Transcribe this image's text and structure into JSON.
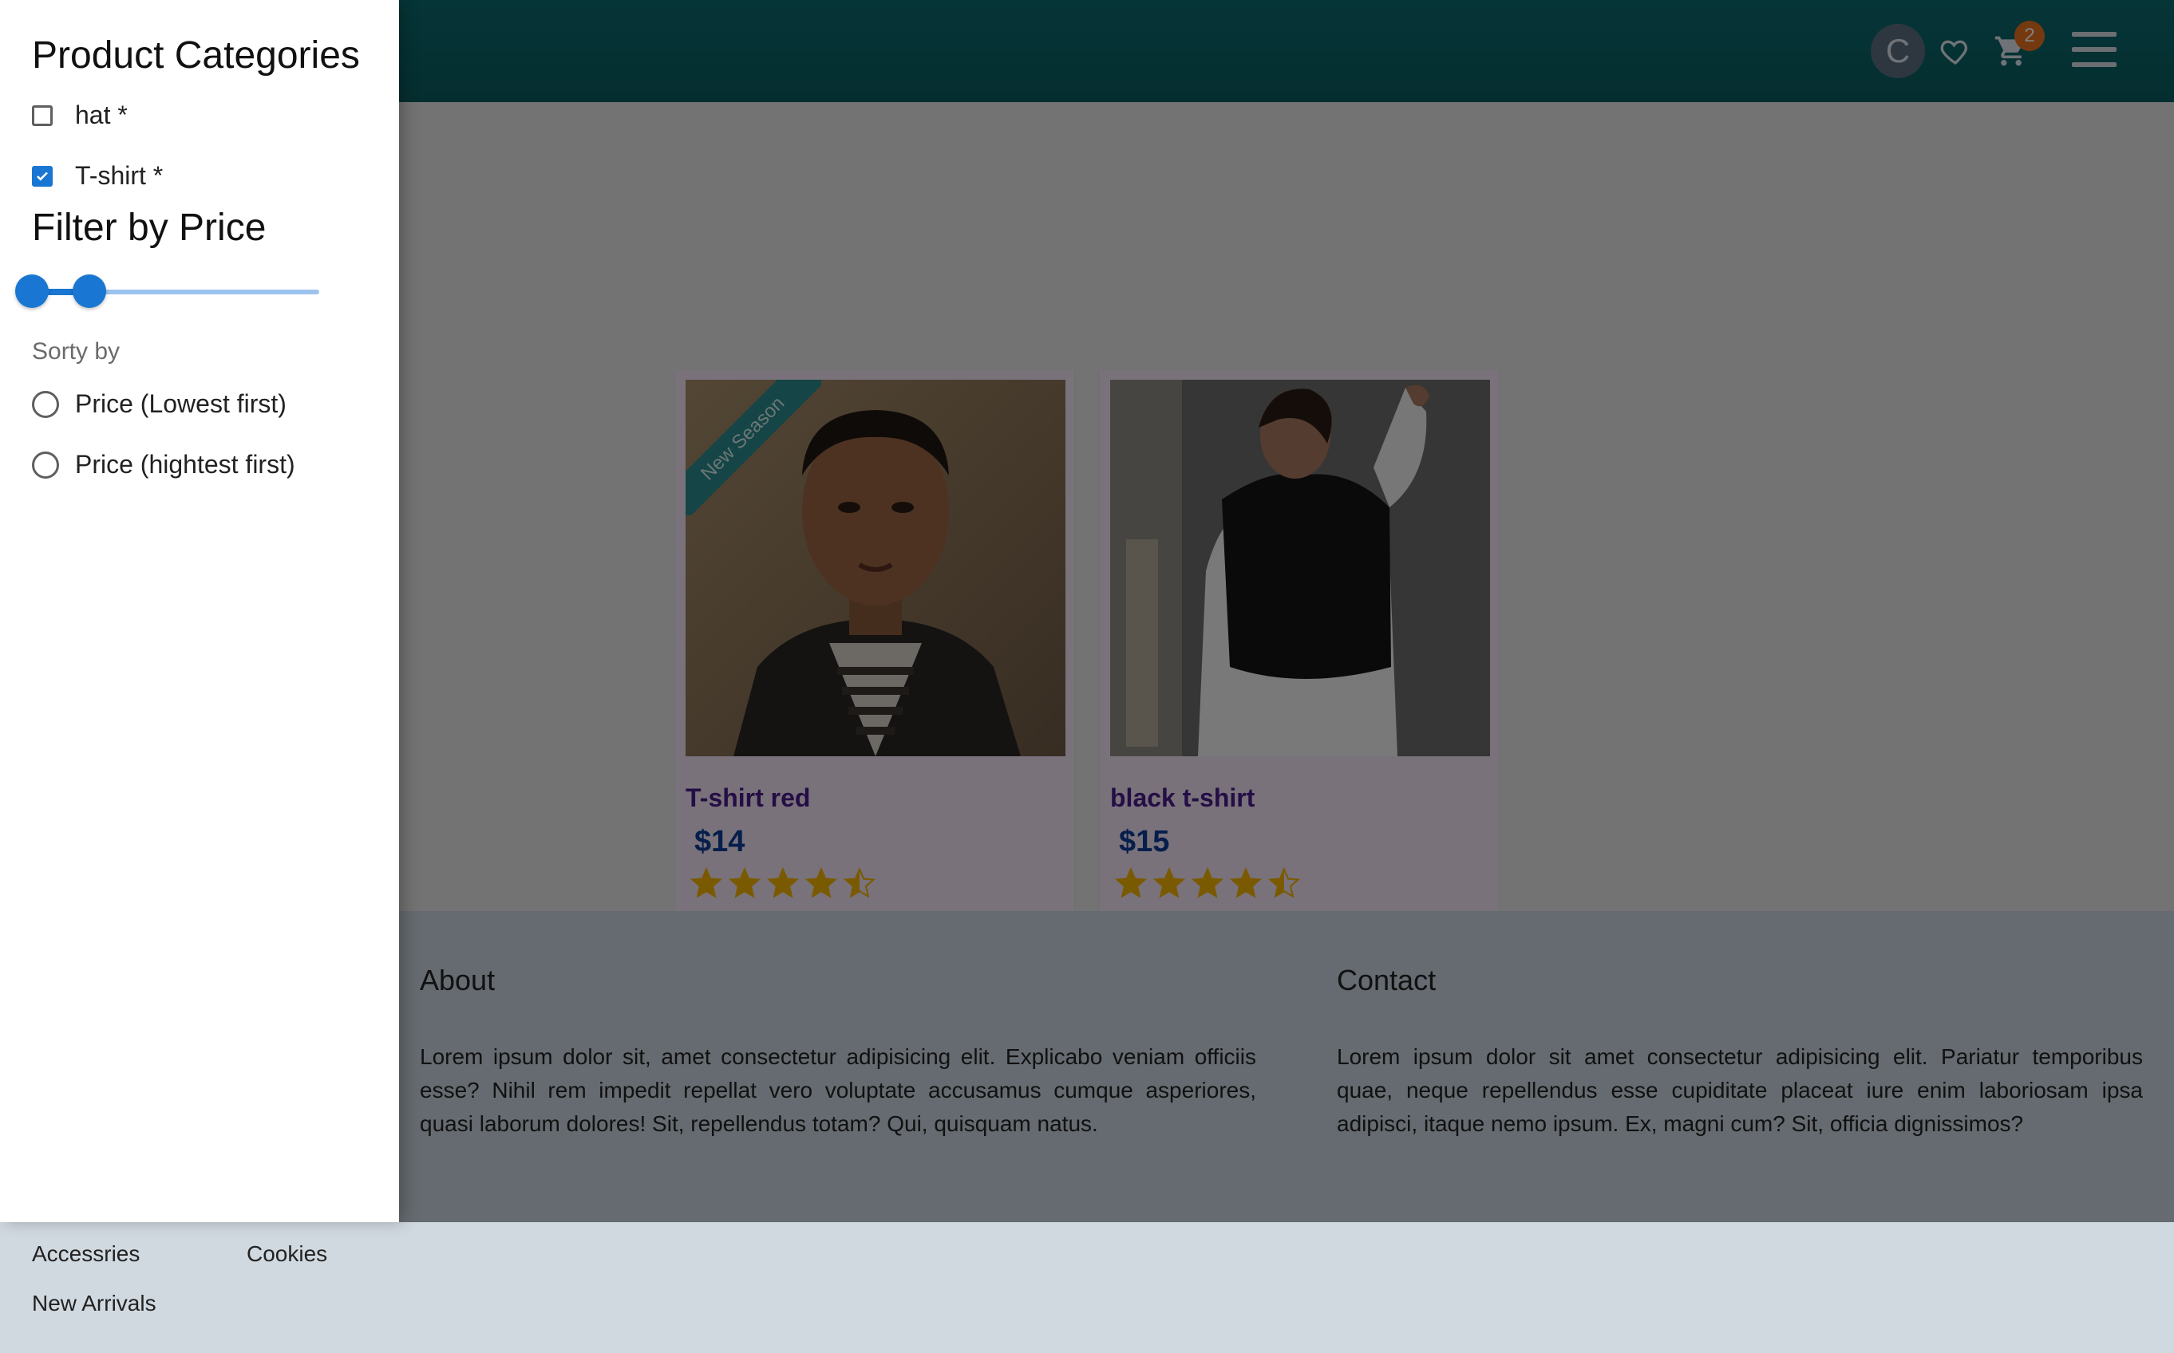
{
  "navbar": {
    "avatar_initial": "C",
    "cart_count": "2",
    "icons": [
      "avatar",
      "heart-icon",
      "cart-icon",
      "menu-icon"
    ]
  },
  "products": [
    {
      "title": "T-shirt red",
      "price": "$14",
      "rating": 4.5,
      "ribbon": "New Season"
    },
    {
      "title": "black t-shirt",
      "price": "$15",
      "rating": 4.5
    }
  ],
  "footer": {
    "about_title": "About",
    "about_text": "Lorem ipsum dolor sit, amet consectetur adipisicing elit. Explicabo veniam officiis esse? Nihil rem impedit repellat vero voluptate accusamus cumque asperiores, quasi laborum dolores! Sit, repellendus totam? Qui, quisquam natus.",
    "contact_title": "Contact",
    "contact_text": "Lorem ipsum dolor sit amet consectetur adipisicing elit. Pariatur temporibus quae, neque repellendus esse cupiditate placeat iure enim laboriosam ipsa adipisci, itaque nemo ipsum. Ex, magni cum? Sit, officia dignissimos?"
  },
  "bottom_links": [
    "Accessries",
    "Cookies",
    "New Arrivals"
  ],
  "drawer": {
    "categories_title": "Product Categories",
    "categories": [
      {
        "label": "hat *",
        "checked": false
      },
      {
        "label": "T-shirt *",
        "checked": true
      }
    ],
    "price_title": "Filter by Price",
    "price_slider_fraction": [
      0.0,
      0.2
    ],
    "sort_title": "Sorty by",
    "sort_options": [
      "Price (Lowest first)",
      "Price (hightest first)"
    ]
  },
  "colors": {
    "navbar": "#0c6b6f",
    "accent": "#1976d2",
    "star": "#f5b400",
    "price": "#0c3d96",
    "title": "#4a1a8a"
  }
}
